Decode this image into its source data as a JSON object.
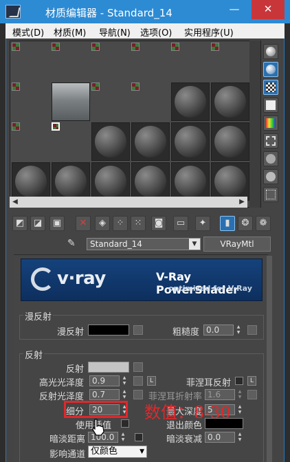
{
  "window": {
    "title": "材质编辑器 - Standard_14",
    "minimize": "—",
    "close": "✕"
  },
  "menu": [
    "模式(D)",
    "材质(M)",
    "导航(N)",
    "选项(O)",
    "实用程序(U)"
  ],
  "material": {
    "name": "Standard_14",
    "type": "VRayMtl"
  },
  "banner": {
    "logo": "v·ray",
    "product": "V-Ray PowerShader",
    "subtitle": "optimized for V-Ray"
  },
  "diffuse_group": {
    "title": "漫反射",
    "diffuse_label": "漫反射",
    "diffuse_color": "#000000",
    "roughness_label": "粗糙度",
    "roughness": "0.0"
  },
  "reflection_group": {
    "title": "反射",
    "reflect_label": "反射",
    "reflect_color": "#c4c4c4",
    "hilight_gloss_label": "高光光泽度",
    "hilight_gloss": "0.9",
    "lock_label": "L",
    "fresnel_label": "菲涅耳反射",
    "fresnel_lock_label": "L",
    "refl_gloss_label": "反射光泽度",
    "refl_gloss": "0.7",
    "fresnel_ior_label": "菲涅耳折射率",
    "fresnel_ior": "1.6",
    "subdivs_label": "细分",
    "subdivs": "20",
    "max_depth_label": "最大深度",
    "max_depth": "5",
    "use_interp_label": "使用插值",
    "exit_color_label": "退出颜色",
    "exit_color": "#000000",
    "dim_dist_label": "暗淡距离",
    "dim_dist": "100.0",
    "dim_falloff_label": "暗淡衰减",
    "dim_falloff": "0.0",
    "affect_channels_label": "影响通道",
    "affect_channels": "仅颜色"
  },
  "annotation": "数值：8-30",
  "colors": {
    "titlebar": "#2d8bd4",
    "close": "#c9363a",
    "annotation": "#e0282c"
  }
}
